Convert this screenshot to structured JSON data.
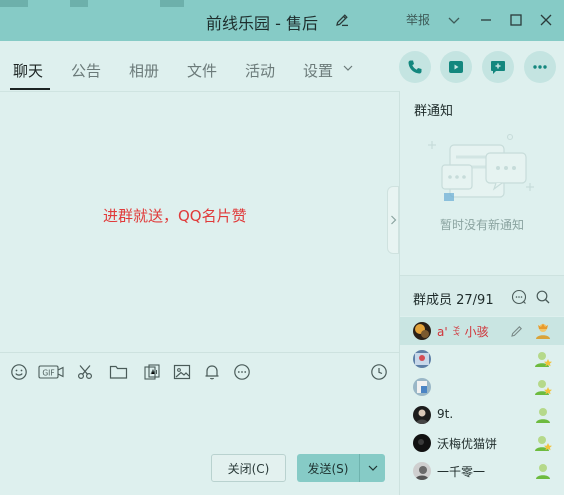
{
  "window": {
    "title": "前线乐园 - 售后",
    "report_label": "举报"
  },
  "tabs": [
    {
      "label": "聊天",
      "active": true
    },
    {
      "label": "公告",
      "active": false
    },
    {
      "label": "相册",
      "active": false
    },
    {
      "label": "文件",
      "active": false
    },
    {
      "label": "活动",
      "active": false
    },
    {
      "label": "设置",
      "active": false
    }
  ],
  "actions": [
    "phone-icon",
    "video-icon",
    "message-plus-icon",
    "more-icon"
  ],
  "chat": {
    "announcement": "进群就送，QQ名片赞"
  },
  "toolbar": [
    "emoji-icon",
    "gif-icon",
    "scissors-icon",
    "folder-icon",
    "template-icon",
    "image-icon",
    "bell-icon",
    "more-icon",
    "history-icon"
  ],
  "buttons": {
    "close_label": "关闭(C)",
    "send_label": "发送(S)"
  },
  "notice": {
    "title": "群通知",
    "empty_text": "暂时没有新通知"
  },
  "members": {
    "title": "群成员 27/91",
    "list": [
      {
        "name": "a' ꉂ 小骇",
        "role": "owner"
      },
      {
        "name": "",
        "role": "admin"
      },
      {
        "name": "",
        "role": "admin"
      },
      {
        "name": "9t.",
        "role": "member"
      },
      {
        "name": "沃梅优猫饼",
        "role": "admin"
      },
      {
        "name": "一千零一",
        "role": "member"
      }
    ]
  },
  "colors": {
    "accent": "#86cbc6",
    "background": "#def0ee",
    "announcement": "#e03a3a"
  }
}
